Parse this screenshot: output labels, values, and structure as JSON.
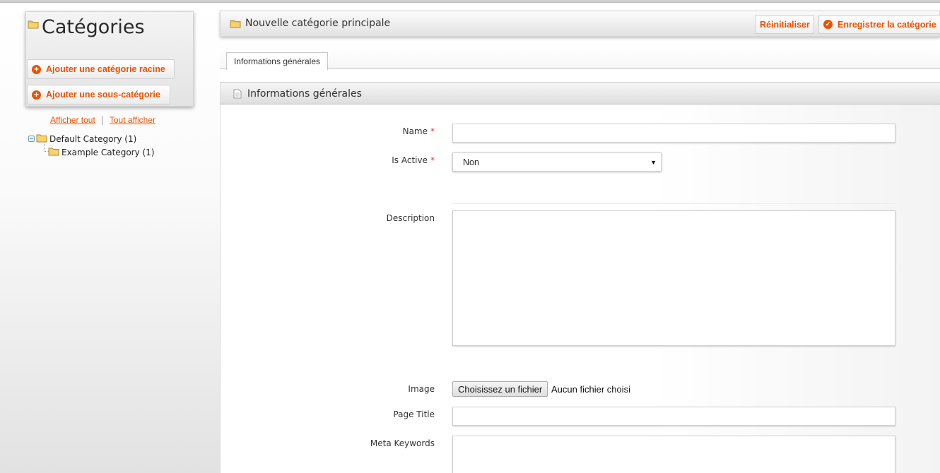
{
  "sidebar": {
    "title": "Catégories",
    "add_root_label": "Ajouter une catégorie racine",
    "add_sub_label": "Ajouter une sous-catégorie",
    "collapse_all": "Afficher tout",
    "expand_all": "Tout afficher",
    "separator": "|",
    "tree": [
      {
        "label": "Default Category (1)"
      },
      {
        "label": "Example Category (1)"
      }
    ]
  },
  "header": {
    "title": "Nouvelle catégorie principale",
    "reset_label": "Réinitialiser",
    "save_label": "Enregistrer la catégorie"
  },
  "tabs": [
    {
      "label": "Informations générales"
    }
  ],
  "section": {
    "title": "Informations générales",
    "fields": {
      "name_label": "Name",
      "name_value": "",
      "is_active_label": "Is Active",
      "is_active_value": "Non",
      "description_label": "Description",
      "description_value": "",
      "image_label": "Image",
      "file_button": "Choisissez un fichier",
      "file_status": "Aucun fichier choisi",
      "page_title_label": "Page Title",
      "page_title_value": "",
      "meta_keywords_label": "Meta Keywords",
      "required_marker": "*"
    }
  },
  "colors": {
    "accent": "#eb5202",
    "required": "#dd3333"
  }
}
